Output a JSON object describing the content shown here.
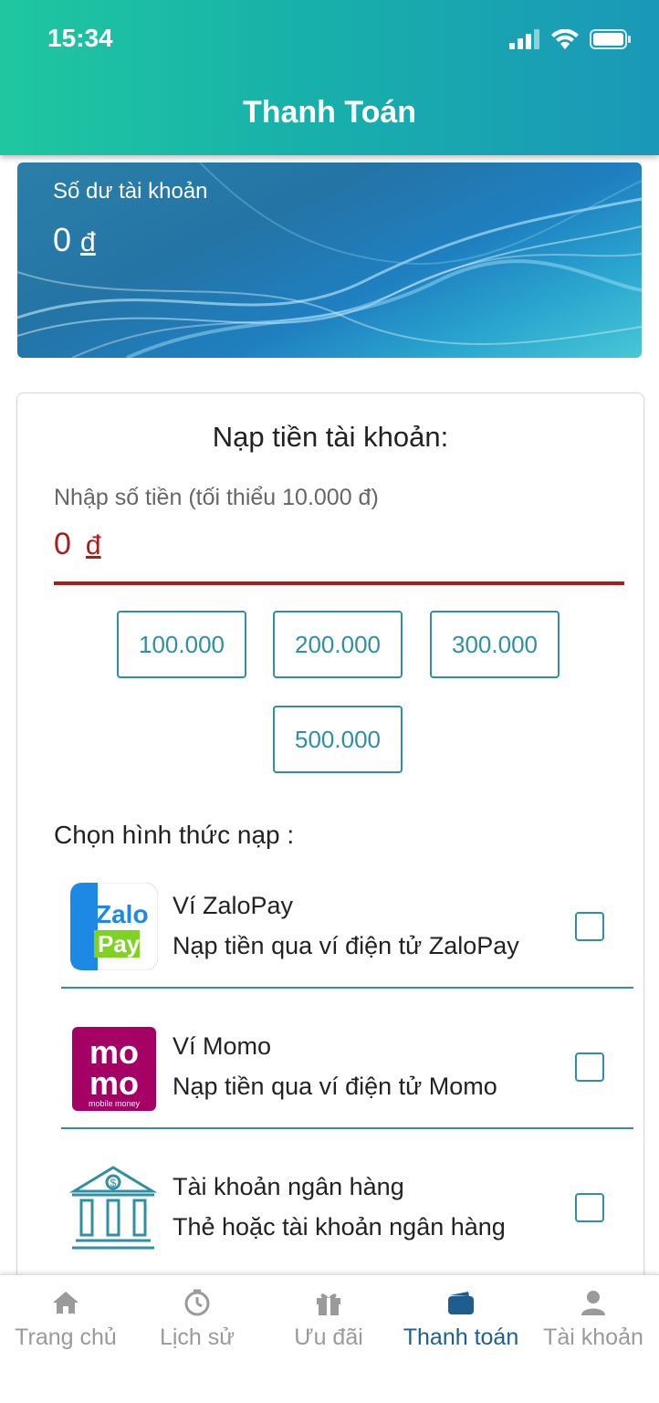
{
  "status_bar": {
    "time": "15:34"
  },
  "header": {
    "title": "Thanh Toán"
  },
  "balance": {
    "label": "Số dư tài khoản",
    "amount": "0",
    "currency": "đ"
  },
  "topup": {
    "title": "Nạp tiền tài khoản:",
    "amount_label": "Nhập số tiền (tối thiểu 10.000 đ)",
    "amount_value": "0",
    "currency": "đ",
    "presets": [
      "100.000",
      "200.000",
      "300.000",
      "500.000"
    ],
    "method_label": "Chọn hình thức nạp :",
    "methods": [
      {
        "name": "Ví ZaloPay",
        "description": "Nạp tiền qua ví điện tử ZaloPay",
        "icon": "zalopay-logo",
        "checked": false
      },
      {
        "name": "Ví Momo",
        "description": "Nạp tiền qua ví điện tử Momo",
        "icon": "momo-logo",
        "logo_text_top": "mo",
        "logo_text_bottom": "mo",
        "logo_caption": "mobile money",
        "checked": false
      },
      {
        "name": "Tài khoản ngân hàng",
        "description": "Thẻ hoặc tài khoản ngân hàng",
        "icon": "bank-icon",
        "checked": false
      }
    ],
    "zalopay_logo": {
      "top": "Zalo",
      "bottom": "Pay"
    }
  },
  "tabs": [
    {
      "label": "Trang chủ",
      "icon": "home-icon",
      "active": false
    },
    {
      "label": "Lịch sử",
      "icon": "history-icon",
      "active": false
    },
    {
      "label": "Ưu đãi",
      "icon": "gift-icon",
      "active": false
    },
    {
      "label": "Thanh toán",
      "icon": "wallet-icon",
      "active": true
    },
    {
      "label": "Tài khoản",
      "icon": "user-icon",
      "active": false
    }
  ],
  "colors": {
    "header_start": "#1fc7a0",
    "header_end": "#1a98b8",
    "accent": "#2f8fa3",
    "amount_red": "#b01a1a",
    "tab_active": "#1f5d8e",
    "tab_inactive": "#9a9a9a"
  }
}
